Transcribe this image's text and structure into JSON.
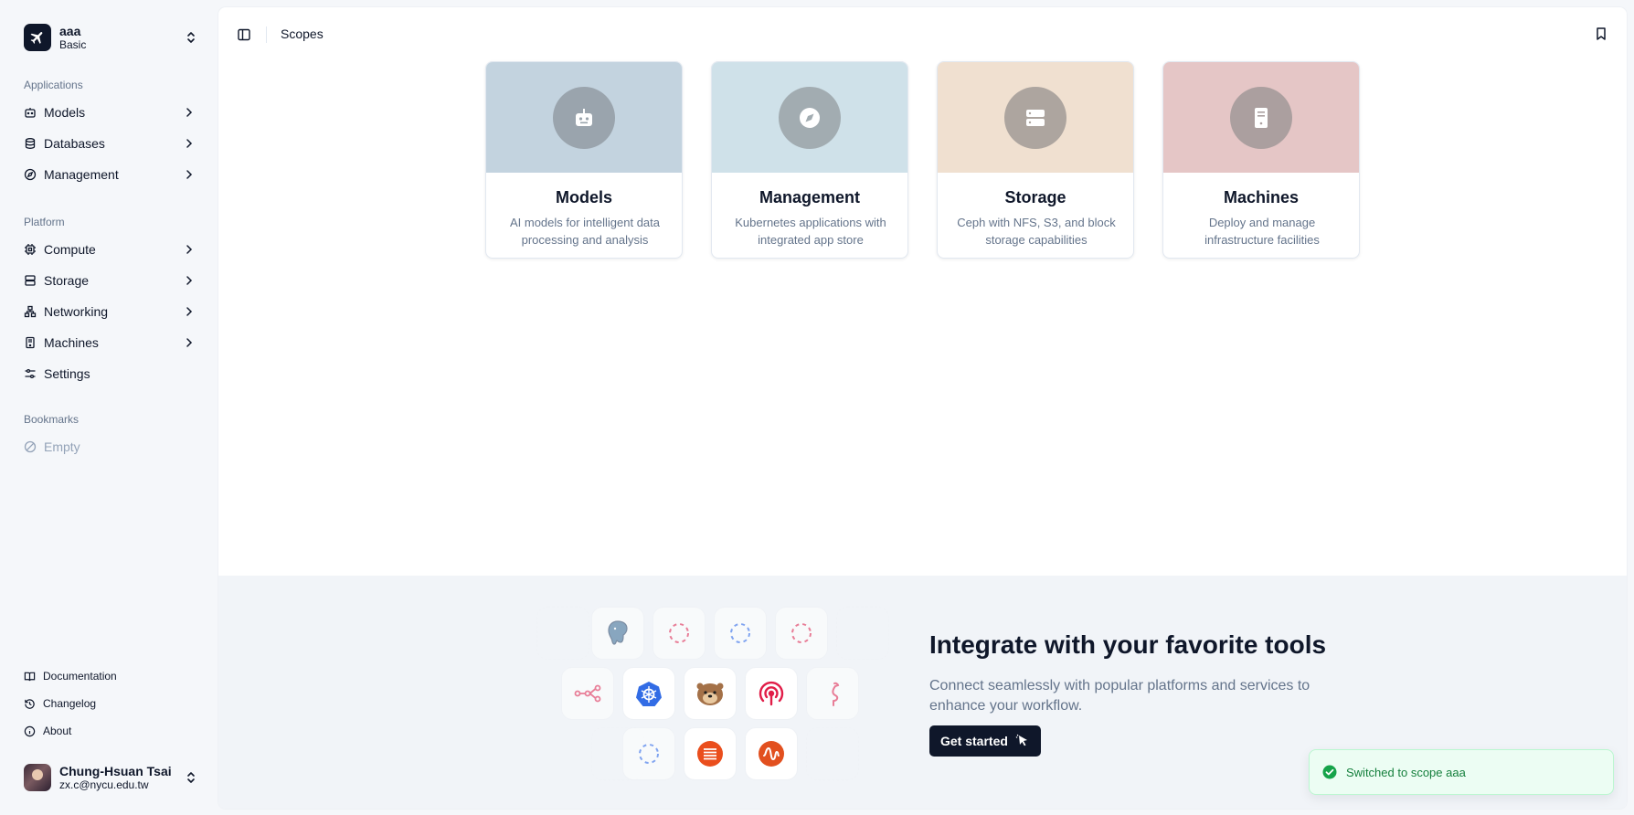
{
  "org": {
    "name": "aaa",
    "plan": "Basic"
  },
  "sidebar": {
    "applications_label": "Applications",
    "applications": [
      {
        "label": "Models",
        "icon": "bot-icon"
      },
      {
        "label": "Databases",
        "icon": "database-icon"
      },
      {
        "label": "Management",
        "icon": "compass-icon"
      }
    ],
    "platform_label": "Platform",
    "platform": [
      {
        "label": "Compute",
        "icon": "cpu-icon"
      },
      {
        "label": "Storage",
        "icon": "server-icon"
      },
      {
        "label": "Networking",
        "icon": "network-icon"
      },
      {
        "label": "Machines",
        "icon": "machine-icon"
      },
      {
        "label": "Settings",
        "icon": "sliders-icon"
      }
    ],
    "bookmarks_label": "Bookmarks",
    "bookmarks_empty": "Empty",
    "footer": [
      {
        "label": "Documentation",
        "icon": "book-icon"
      },
      {
        "label": "Changelog",
        "icon": "history-icon"
      },
      {
        "label": "About",
        "icon": "info-icon"
      }
    ]
  },
  "user": {
    "name": "Chung-Hsuan Tsai",
    "email": "zx.c@nycu.edu.tw"
  },
  "header": {
    "breadcrumb": "Scopes"
  },
  "cards": [
    {
      "title": "Models",
      "description": "AI models for intelligent data processing and analysis",
      "bg": "#c3d3df",
      "circle": "#9aa4ad"
    },
    {
      "title": "Management",
      "description": "Kubernetes applications with integrated app store",
      "bg": "#cfe1e9",
      "circle": "#a2acb1"
    },
    {
      "title": "Storage",
      "description": "Ceph with NFS, S3, and block storage capabilities",
      "bg": "#f0e0d0",
      "circle": "#ada59f"
    },
    {
      "title": "Machines",
      "description": "Deploy and manage infrastructure facilities",
      "bg": "#e5c6c6",
      "circle": "#ab9f9f"
    }
  ],
  "integrations": {
    "title": "Integrate with your favorite tools",
    "description": "Connect seamlessly with popular platforms and services to enhance your workflow.",
    "button": "Get started"
  },
  "toast": {
    "message": "Switched to scope aaa"
  }
}
